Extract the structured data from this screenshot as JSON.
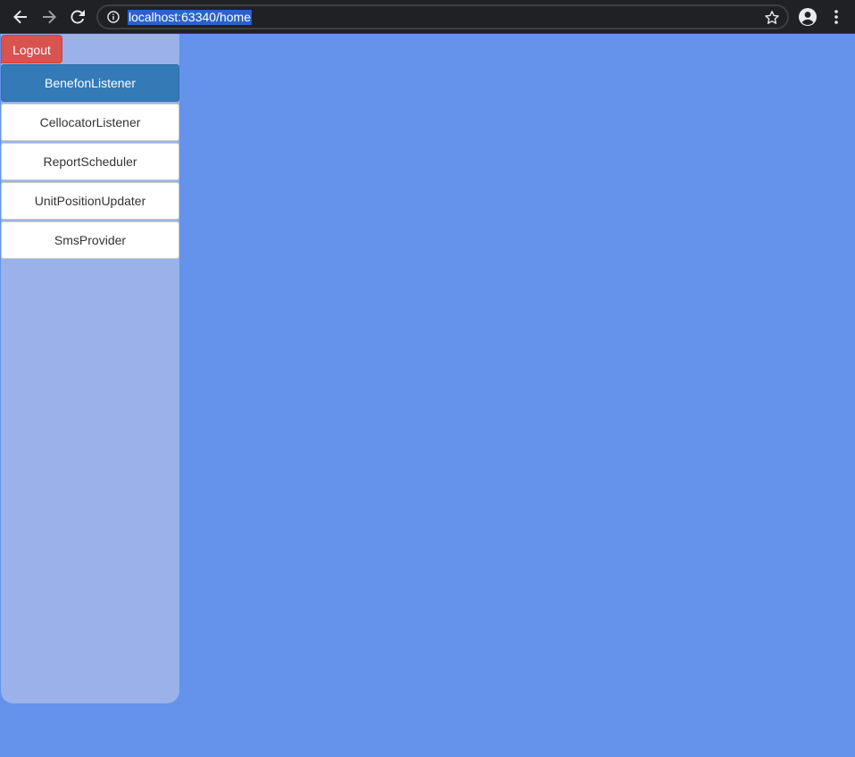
{
  "browser": {
    "url": "localhost:63340/home",
    "icons": {
      "back": "arrow-left-icon",
      "forward": "arrow-right-icon",
      "reload": "reload-icon",
      "site_info": "info-icon",
      "bookmark": "star-icon",
      "profile": "account-circle-icon",
      "menu": "kebab-menu-icon"
    }
  },
  "page": {
    "logout_label": "Logout",
    "menu": [
      {
        "label": "BenefonListener",
        "active": true
      },
      {
        "label": "CellocatorListener",
        "active": false
      },
      {
        "label": "ReportScheduler",
        "active": false
      },
      {
        "label": "UnitPositionUpdater",
        "active": false
      },
      {
        "label": "SmsProvider",
        "active": false
      }
    ]
  },
  "colors": {
    "page_background": "#6593ec",
    "sidebar_background": "#9ab2e9",
    "logout_button": "#d9534f",
    "active_item": "#337ab7"
  }
}
